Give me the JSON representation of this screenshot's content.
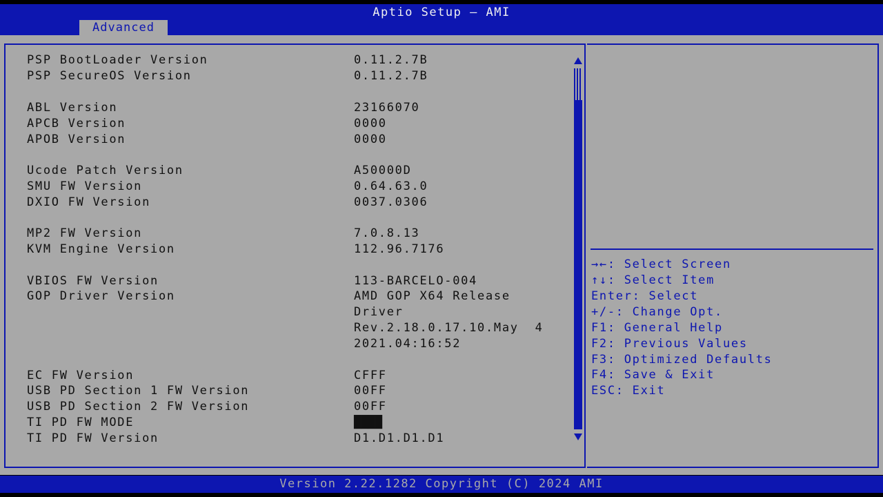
{
  "header": {
    "title": "Aptio Setup – AMI",
    "tabs": [
      {
        "label": "Advanced",
        "active": true
      }
    ]
  },
  "info_rows": [
    {
      "label": "PSP BootLoader Version",
      "value": "0.11.2.7B"
    },
    {
      "label": "PSP SecureOS Version",
      "value": "0.11.2.7B"
    },
    {
      "label": "ABL Version",
      "value": "23166070"
    },
    {
      "label": "APCB Version",
      "value": "0000"
    },
    {
      "label": "APOB Version",
      "value": "0000"
    },
    {
      "label": "Ucode Patch Version",
      "value": "A50000D"
    },
    {
      "label": "SMU FW Version",
      "value": "0.64.63.0"
    },
    {
      "label": "DXIO FW Version",
      "value": "0037.0306"
    },
    {
      "label": "MP2 FW Version",
      "value": "7.0.8.13"
    },
    {
      "label": "KVM Engine Version",
      "value": "112.96.7176"
    },
    {
      "label": "VBIOS FW Version",
      "value": "113-BARCELO-004"
    },
    {
      "label": "GOP Driver Version",
      "value": "AMD GOP X64 Release",
      "value_lines": [
        "Driver",
        "Rev.2.18.0.17.10.May  4",
        "2021.04:16:52"
      ]
    },
    {
      "label": "EC FW Version",
      "value": "CFFF"
    },
    {
      "label": "USB PD Section 1 FW Version",
      "value": "00FF"
    },
    {
      "label": "USB PD Section 2 FW Version",
      "value": "00FF"
    },
    {
      "label": "TI PD FW MODE",
      "value": "████"
    },
    {
      "label": "TI PD FW Version",
      "value": "D1.D1.D1.D1"
    }
  ],
  "help": {
    "keys": [
      "→←: Select Screen",
      "↑↓: Select Item",
      "Enter: Select",
      "+/-: Change Opt.",
      "F1: General Help",
      "F2: Previous Values",
      "F3: Optimized Defaults",
      "F4: Save & Exit",
      "ESC: Exit"
    ]
  },
  "footer": {
    "text": "Version 2.22.1282 Copyright (C) 2024 AMI"
  },
  "colors": {
    "bios_blue": "#0d16b0",
    "panel_gray": "#a8a8a8",
    "text_dark": "#111111",
    "text_light": "#f0f0f0"
  }
}
